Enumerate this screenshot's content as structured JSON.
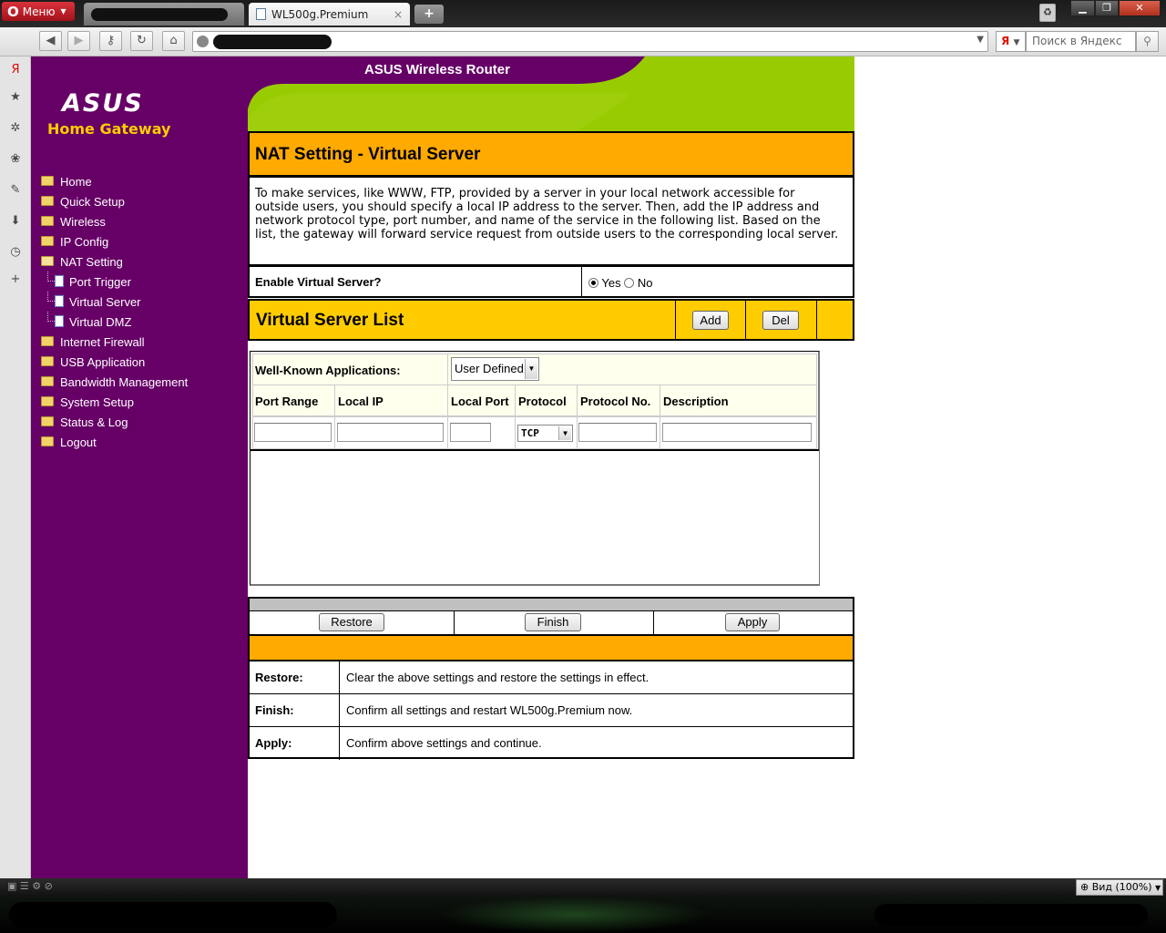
{
  "browser": {
    "menu_label": "Меню",
    "active_tab_title": "WL500g.Premium",
    "tab_close": "×",
    "search_engine_glyph": "Я",
    "search_placeholder": "Поиск в Яндекс",
    "zoom_label": "Вид (100%)"
  },
  "router": {
    "banner_title": "ASUS Wireless Router",
    "logo": "ASUS",
    "logo_subtitle": "Home Gateway",
    "menu": [
      {
        "label": "Home"
      },
      {
        "label": "Quick Setup"
      },
      {
        "label": "Wireless"
      },
      {
        "label": "IP Config"
      },
      {
        "label": "NAT Setting"
      },
      {
        "label": "Port Trigger"
      },
      {
        "label": "Virtual Server"
      },
      {
        "label": "Virtual DMZ"
      },
      {
        "label": "Internet Firewall"
      },
      {
        "label": "USB Application"
      },
      {
        "label": "Bandwidth Management"
      },
      {
        "label": "System Setup"
      },
      {
        "label": "Status & Log"
      },
      {
        "label": "Logout"
      }
    ]
  },
  "page": {
    "title": "NAT Setting - Virtual Server",
    "description": "To make services, like WWW, FTP, provided by a server in your local network accessible for outside users, you should specify a local IP address to the server. Then, add the IP address and network protocol type, port number, and name of the service in the following list. Based on the list, the gateway will forward service request from outside users to the corresponding local server.",
    "enable_label": "Enable Virtual Server?",
    "enable_yes": "Yes",
    "enable_no": "No",
    "enable_value": "Yes",
    "list_title": "Virtual Server List",
    "add_label": "Add",
    "del_label": "Del",
    "well_known_label": "Well-Known Applications:",
    "well_known_value": "User Defined",
    "columns": [
      "Port Range",
      "Local IP",
      "Local Port",
      "Protocol",
      "Protocol No.",
      "Description"
    ],
    "protocol_value": "TCP",
    "actions": {
      "restore": "Restore",
      "finish": "Finish",
      "apply": "Apply"
    },
    "help": [
      {
        "key": "Restore:",
        "text": "Clear the above settings and restore the settings in effect."
      },
      {
        "key": "Finish:",
        "text": "Confirm all settings and restart WL500g.Premium now."
      },
      {
        "key": "Apply:",
        "text": "Confirm above settings and continue."
      }
    ]
  }
}
